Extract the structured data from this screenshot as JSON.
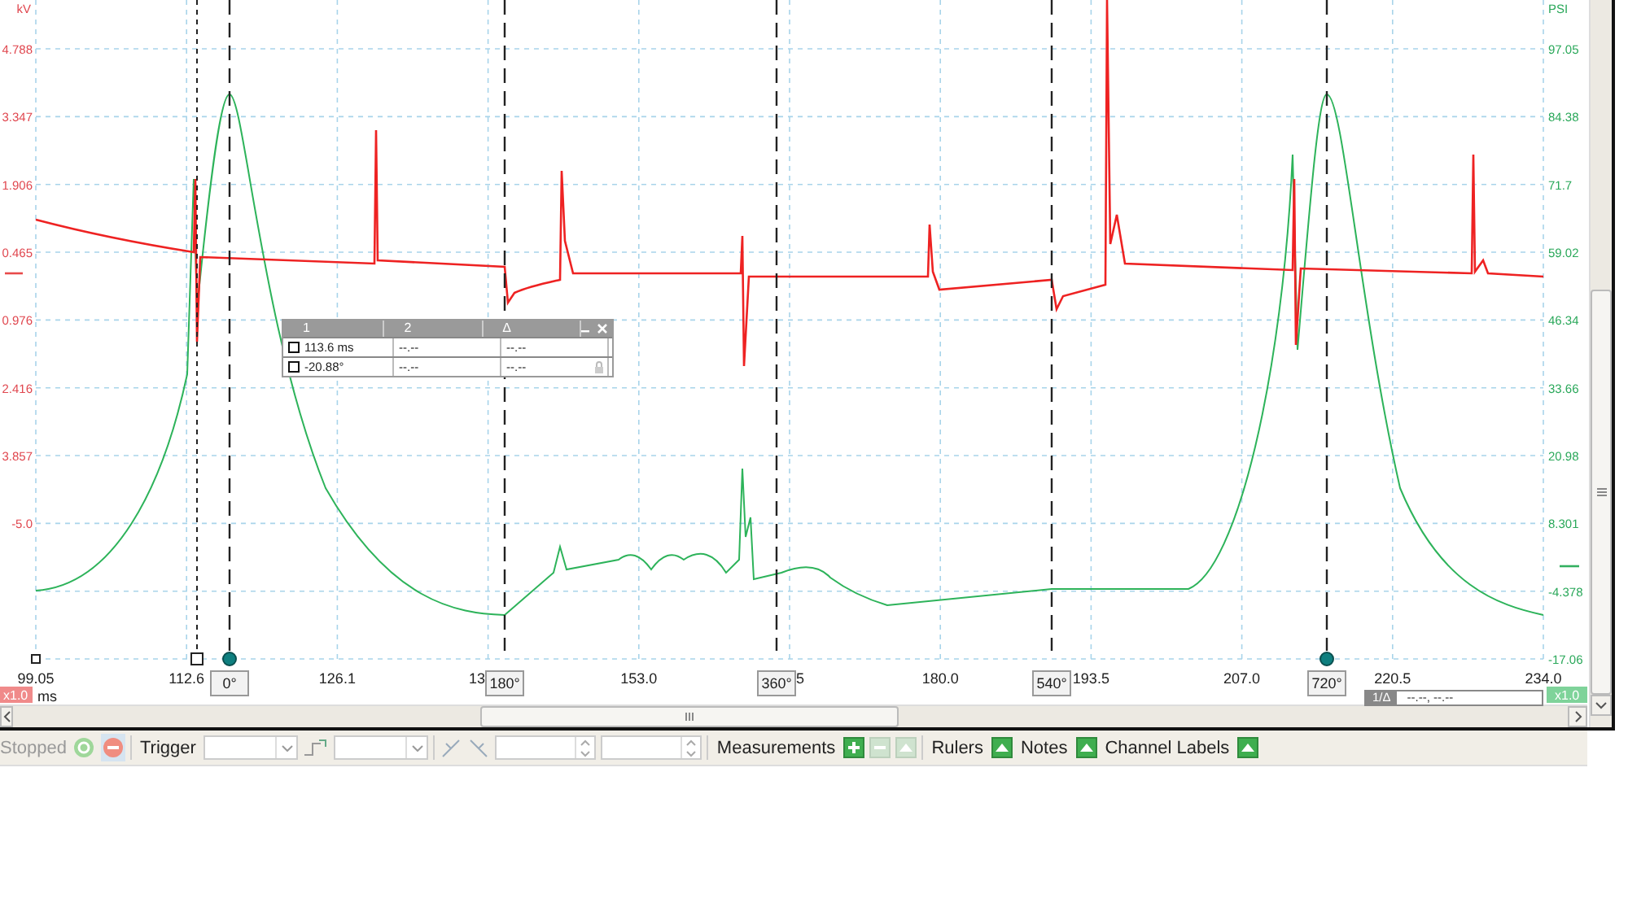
{
  "left_axis": {
    "unit": "kV",
    "ticks": [
      "4.788",
      "3.347",
      "1.906",
      "0.465",
      "0.976",
      "2.416",
      "3.857",
      "-5.0"
    ],
    "zoom": "x1.0"
  },
  "right_axis": {
    "unit": "PSI",
    "ticks": [
      "97.05",
      "84.38",
      "71.7",
      "59.02",
      "46.34",
      "33.66",
      "20.98",
      "8.301",
      "-4.378",
      "-17.06"
    ],
    "zoom": "x1.0"
  },
  "time_axis": {
    "unit": "ms",
    "ticks": [
      "99.05",
      "112.6",
      "126.1",
      "13",
      "153.0",
      "5",
      "180.0",
      "193.5",
      "207.0",
      "220.5",
      "234.0"
    ]
  },
  "rulers": [
    {
      "label": "0°"
    },
    {
      "label": "180°"
    },
    {
      "label": "360°"
    },
    {
      "label": "540°"
    },
    {
      "label": "720°"
    }
  ],
  "ruler_legend": {
    "columns": [
      "1",
      "2",
      "Δ"
    ],
    "rows": [
      {
        "checked": false,
        "cells": [
          "113.6 ms",
          "--.--",
          "--.--"
        ]
      },
      {
        "checked": false,
        "cells": [
          "-20.88°",
          "--.--",
          "--.--"
        ]
      }
    ]
  },
  "frequency_readout": {
    "label": "1/Δ",
    "value": "--.--, --.--"
  },
  "toolbar": [
    {
      "kind": "status",
      "text": "Stopped"
    },
    {
      "kind": "start-button",
      "pressed": false
    },
    {
      "kind": "stop-button",
      "pressed": true
    },
    {
      "kind": "separator"
    },
    {
      "kind": "label",
      "text": "Trigger"
    },
    {
      "kind": "combo"
    },
    {
      "kind": "edge-button"
    },
    {
      "kind": "combo"
    },
    {
      "kind": "separator"
    },
    {
      "kind": "cursor-buttons"
    },
    {
      "kind": "spin"
    },
    {
      "kind": "spin"
    },
    {
      "kind": "separator"
    },
    {
      "kind": "label",
      "text": "Measurements"
    },
    {
      "kind": "add-button",
      "disabled": false
    },
    {
      "kind": "remove-button",
      "disabled": true
    },
    {
      "kind": "edit-button",
      "disabled": true
    },
    {
      "kind": "separator"
    },
    {
      "kind": "label",
      "text": "Rulers"
    },
    {
      "kind": "up-button",
      "disabled": false
    },
    {
      "kind": "label",
      "text": "Notes"
    },
    {
      "kind": "up-button",
      "disabled": false
    },
    {
      "kind": "label",
      "text": "Channel Labels"
    },
    {
      "kind": "up-button",
      "disabled": false
    }
  ]
}
